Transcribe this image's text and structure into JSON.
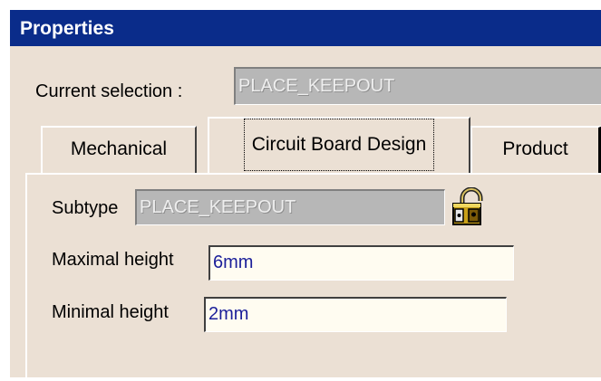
{
  "window": {
    "title": "Properties"
  },
  "selection": {
    "label": "Current selection :",
    "value": "PLACE_KEEPOUT"
  },
  "tabs": [
    {
      "label": "Mechanical"
    },
    {
      "label": "Circuit Board Design"
    },
    {
      "label": "Product"
    }
  ],
  "panel": {
    "subtype": {
      "label": "Subtype",
      "value": "PLACE_KEEPOUT",
      "icon": "padlock-icon"
    },
    "max_height": {
      "label": "Maximal height",
      "value": "6mm"
    },
    "min_height": {
      "label": "Minimal height",
      "value": "2mm"
    }
  },
  "colors": {
    "titlebar": "#0a2c8a",
    "dialog_bg": "#ebe0d4",
    "field_bg": "#fffcf1",
    "field_text": "#1b1f9a",
    "lock_body": "#c8a018"
  }
}
